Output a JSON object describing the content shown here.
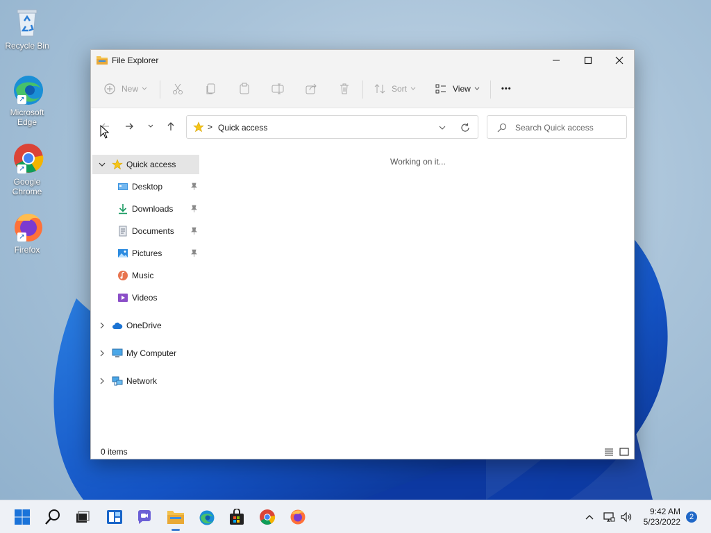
{
  "desktop": {
    "icons": [
      {
        "label": "Recycle Bin"
      },
      {
        "label": "Microsoft Edge"
      },
      {
        "label": "Google Chrome"
      },
      {
        "label": "Firefox"
      }
    ]
  },
  "window": {
    "title": "File Explorer",
    "controls": [
      "minimize-icon",
      "maximize-icon",
      "close-icon"
    ]
  },
  "toolbar": {
    "new_label": "New",
    "sort_label": "Sort",
    "view_label": "View",
    "more_label": "•••",
    "icons": [
      "cut-icon",
      "copy-icon",
      "paste-icon",
      "rename-icon",
      "share-icon",
      "delete-icon"
    ]
  },
  "address": {
    "crumb": "Quick access",
    "separator": ">"
  },
  "search": {
    "placeholder": "Search Quick access"
  },
  "nav": {
    "quick_access": "Quick access",
    "items": [
      {
        "label": "Desktop",
        "pinned": true
      },
      {
        "label": "Downloads",
        "pinned": true
      },
      {
        "label": "Documents",
        "pinned": true
      },
      {
        "label": "Pictures",
        "pinned": true
      },
      {
        "label": "Music",
        "pinned": false
      },
      {
        "label": "Videos",
        "pinned": false
      }
    ],
    "onedrive": "OneDrive",
    "my_computer": "My Computer",
    "network": "Network"
  },
  "content": {
    "message": "Working on it..."
  },
  "status": {
    "items_text": "0 items"
  },
  "taskbar": {
    "time": "9:42 AM",
    "date": "5/23/2022",
    "notification_count": "2"
  },
  "colors": {
    "accent": "#1f67c7",
    "selection": "#e5e5e5",
    "folder": "#f2c14e"
  }
}
